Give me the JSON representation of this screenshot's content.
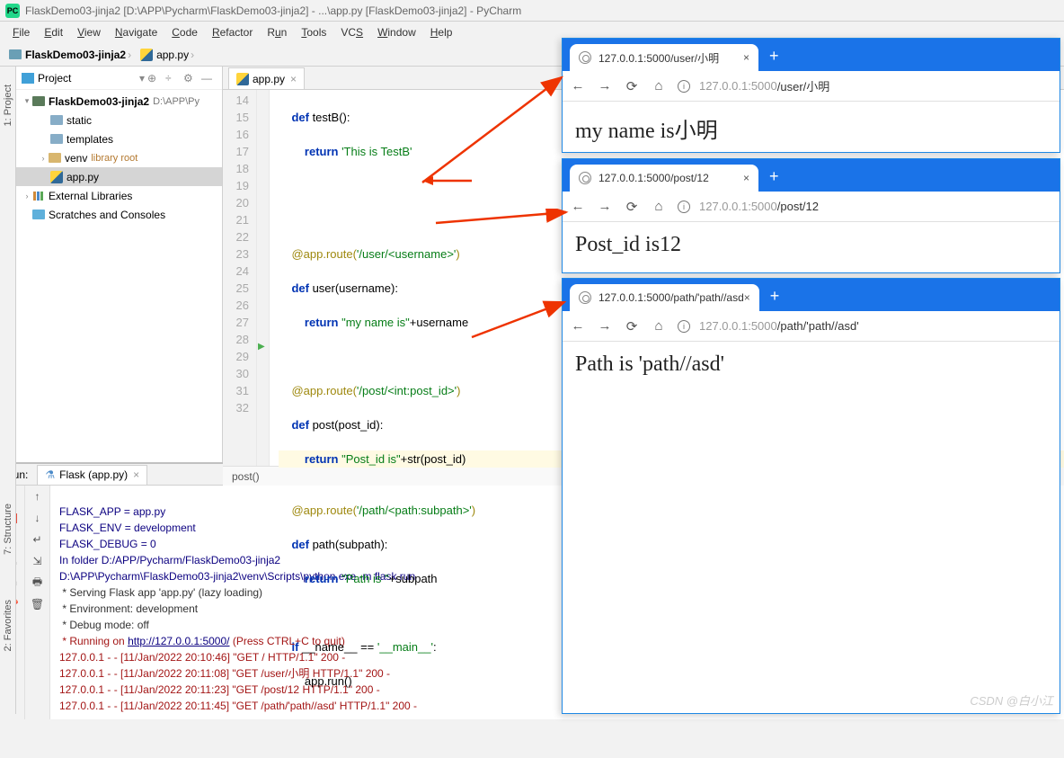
{
  "title": "FlaskDemo03-jinja2 [D:\\APP\\Pycharm\\FlaskDemo03-jinja2] - ...\\app.py [FlaskDemo03-jinja2] - PyCharm",
  "menu": [
    "File",
    "Edit",
    "View",
    "Navigate",
    "Code",
    "Refactor",
    "Run",
    "Tools",
    "VCS",
    "Window",
    "Help"
  ],
  "breadcrumb": {
    "project": "FlaskDemo03-jinja2",
    "file": "app.py"
  },
  "project_panel": {
    "header": "Project",
    "root": "FlaskDemo03-jinja2",
    "root_path": "D:\\APP\\Py",
    "items": [
      "static",
      "templates",
      "venv",
      "app.py"
    ],
    "venv_hint": "library root",
    "external": "External Libraries",
    "scratches": "Scratches and Consoles"
  },
  "editor_tab": "app.py",
  "line_numbers": [
    "14",
    "15",
    "16",
    "17",
    "18",
    "19",
    "20",
    "21",
    "22",
    "23",
    "24",
    "25",
    "26",
    "27",
    "28",
    "29",
    "30",
    "31",
    "32"
  ],
  "code": {
    "l14": "def testB():",
    "l15_ret": "return ",
    "l15_str": "'This is TestB'",
    "l18_dec": "@app.route(",
    "l18_str": "'/user/<username>'",
    "l18_end": ")",
    "l19": "def user(username):",
    "l20_ret": "return ",
    "l20_str": "\"my name is\"",
    "l20_end": "+username",
    "l22_dec": "@app.route(",
    "l22_str": "'/post/<int:post_id>'",
    "l22_end": ")",
    "l23": "def post(post_id):",
    "l24_ret": "return ",
    "l24_str": "\"Post_id is\"",
    "l24_mid": "+str(post_id)",
    "l26_dec": "@app.route(",
    "l26_str": "'/path/<path:subpath>'",
    "l26_end": ")",
    "l27": "def path(subpath):",
    "l28_ret": "return ",
    "l28_str": "\"Path is \"",
    "l28_end": "+subpath",
    "l30a": "if __name__ == ",
    "l30b": "'__main__'",
    "l30c": ":",
    "l31": "app.run()"
  },
  "editor_breadcrumb": "post()",
  "run_label": "Run:",
  "run_tab": "Flask (app.py)",
  "console": {
    "l1": "FLASK_APP = app.py",
    "l2": "FLASK_ENV = development",
    "l3": "FLASK_DEBUG = 0",
    "l4": "In folder D:/APP/Pycharm/FlaskDemo03-jinja2",
    "l5": "D:\\APP\\Pycharm\\FlaskDemo03-jinja2\\venv\\Scripts\\python.exe -m flask run",
    "l6": " * Serving Flask app 'app.py' (lazy loading)",
    "l7": " * Environment: development",
    "l8": " * Debug mode: off",
    "l9a": " * Running on ",
    "l9link": "http://127.0.0.1:5000/",
    "l9b": " (Press CTRL+C to quit)",
    "l10": "127.0.0.1 - - [11/Jan/2022 20:10:46] \"GET / HTTP/1.1\" 200 -",
    "l11": "127.0.0.1 - - [11/Jan/2022 20:11:08] \"GET /user/小明 HTTP/1.1\" 200 -",
    "l12": "127.0.0.1 - - [11/Jan/2022 20:11:23] \"GET /post/12 HTTP/1.1\" 200 -",
    "l13": "127.0.0.1 - - [11/Jan/2022 20:11:45] \"GET /path/'path//asd' HTTP/1.1\" 200 -"
  },
  "browsers": [
    {
      "tab": "127.0.0.1:5000/user/小明",
      "url_host": "127.0.0.1:5000",
      "url_path": "/user/小明",
      "content": "my name is小明"
    },
    {
      "tab": "127.0.0.1:5000/post/12",
      "url_host": "127.0.0.1:5000",
      "url_path": "/post/12",
      "content": "Post_id is12"
    },
    {
      "tab": "127.0.0.1:5000/path/'path//asd",
      "url_host": "127.0.0.1:5000",
      "url_path": "/path/'path//asd'",
      "content": "Path is 'path//asd'"
    }
  ],
  "side_labels": {
    "project": "1: Project",
    "structure": "7: Structure",
    "favorites": "2: Favorites"
  },
  "watermark": "CSDN @白小江"
}
